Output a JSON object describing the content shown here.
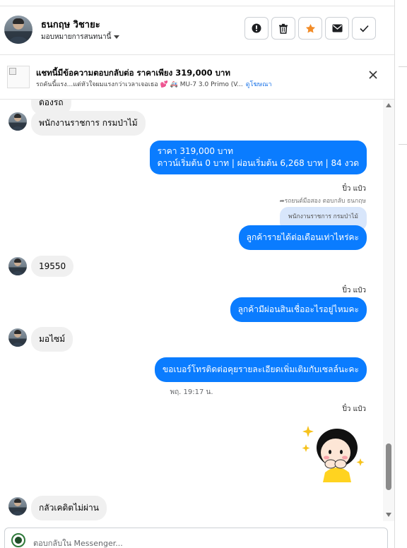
{
  "header": {
    "contact_name": "ธนกฤษ วิชายะ",
    "assign_label": "มอบหมายการสนทนานี้",
    "actions": [
      {
        "name": "report-icon"
      },
      {
        "name": "trash-icon"
      },
      {
        "name": "star-icon",
        "color": "#f28c28"
      },
      {
        "name": "mail-icon"
      },
      {
        "name": "check-icon"
      }
    ]
  },
  "banner": {
    "title": "แชทนี้มีข้อความตอบกลับต่อ ราคาเพียง 319,000 บาท",
    "subtitle": "รถคันนี้แรง...แต่หัวใจผมแรงกว่าเวลาเจอเธอ 💕 🚑 MU-7 3.0 Primo (V...",
    "link": "ดูโฆษณา"
  },
  "messages": {
    "m1_partial": "ต้องรถ",
    "m2": "พนักงานราชการ กรมป่าไม้",
    "m3_line1": "ราคา 319,000 บาท",
    "m3_line2": "ดาวน์เริ่มต้น 0 บาท | ผ่อนเริ่มต้น 6,268 บาท | 84 งวด",
    "sender1": "ปิ๋ว แป๋ว",
    "reply_note": "รถยนต์มือสอง ตอบกลับ ธนกฤษ",
    "quoted": "พนักงานราชการ กรมป่าไม้",
    "m4": "ลูกค้ารายได้ต่อเดือนเท่าไหร่คะ",
    "m5": "19550",
    "sender2": "ปิ๋ว แป๋ว",
    "m6": "ลูกค้ามีผ่อนสินเชื่ออะไรอยู่ไหมคะ",
    "m7": "มอไซม์",
    "m8": "ขอเบอร์โทรติดต่อคุยรายละเอียดเพิ่มเติมกับเซลล์นะคะ",
    "timestamp": "พฤ. 19:17 น.",
    "sender3": "ปิ๋ว แป๋ว",
    "sticker": "sticker-girl-hands-on-cheeks",
    "m9": "กลัวเคดิตไม่ผ่าน"
  },
  "composer": {
    "placeholder": "ตอบกลับใน Messenger..."
  },
  "colors": {
    "outgoing_bubble": "#0a7cff",
    "incoming_bubble": "#f0f0f0",
    "link": "#1a73e8"
  }
}
